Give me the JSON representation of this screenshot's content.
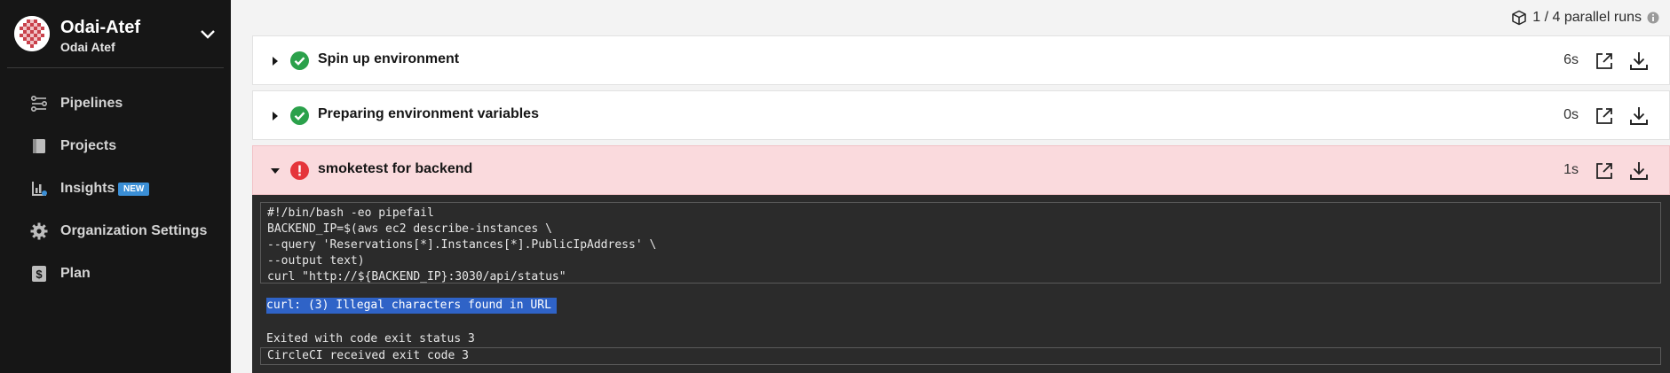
{
  "org": {
    "name": "Odai-Atef",
    "user": "Odai Atef"
  },
  "nav": [
    {
      "label": "Pipelines",
      "icon": "pipelines-icon"
    },
    {
      "label": "Projects",
      "icon": "projects-icon"
    },
    {
      "label": "Insights",
      "icon": "insights-icon",
      "badge": "NEW"
    },
    {
      "label": "Organization Settings",
      "icon": "gear-icon"
    },
    {
      "label": "Plan",
      "icon": "dollar-icon"
    }
  ],
  "parallel_runs": "1 / 4 parallel runs",
  "steps": [
    {
      "title": "Spin up environment",
      "duration": "6s",
      "status": "success"
    },
    {
      "title": "Preparing environment variables",
      "duration": "0s",
      "status": "success"
    },
    {
      "title": "smoketest for backend",
      "duration": "1s",
      "status": "failed"
    }
  ],
  "terminal": {
    "command_lines": [
      "#!/bin/bash -eo pipefail",
      "BACKEND_IP=$(aws ec2 describe-instances \\",
      "--query 'Reservations[*].Instances[*].PublicIpAddress' \\",
      "--output text)",
      "curl \"http://${BACKEND_IP}:3030/api/status\""
    ],
    "error_line": "curl: (3) Illegal characters found in URL",
    "exit_line": "Exited with code exit status 3",
    "circleci_line": "CircleCI received exit code 3"
  },
  "colors": {
    "sidebar": "#161616",
    "success": "#2ba14b",
    "failed": "#e5353b",
    "failed_bg": "#fadadd",
    "badge": "#3b8fd6"
  }
}
